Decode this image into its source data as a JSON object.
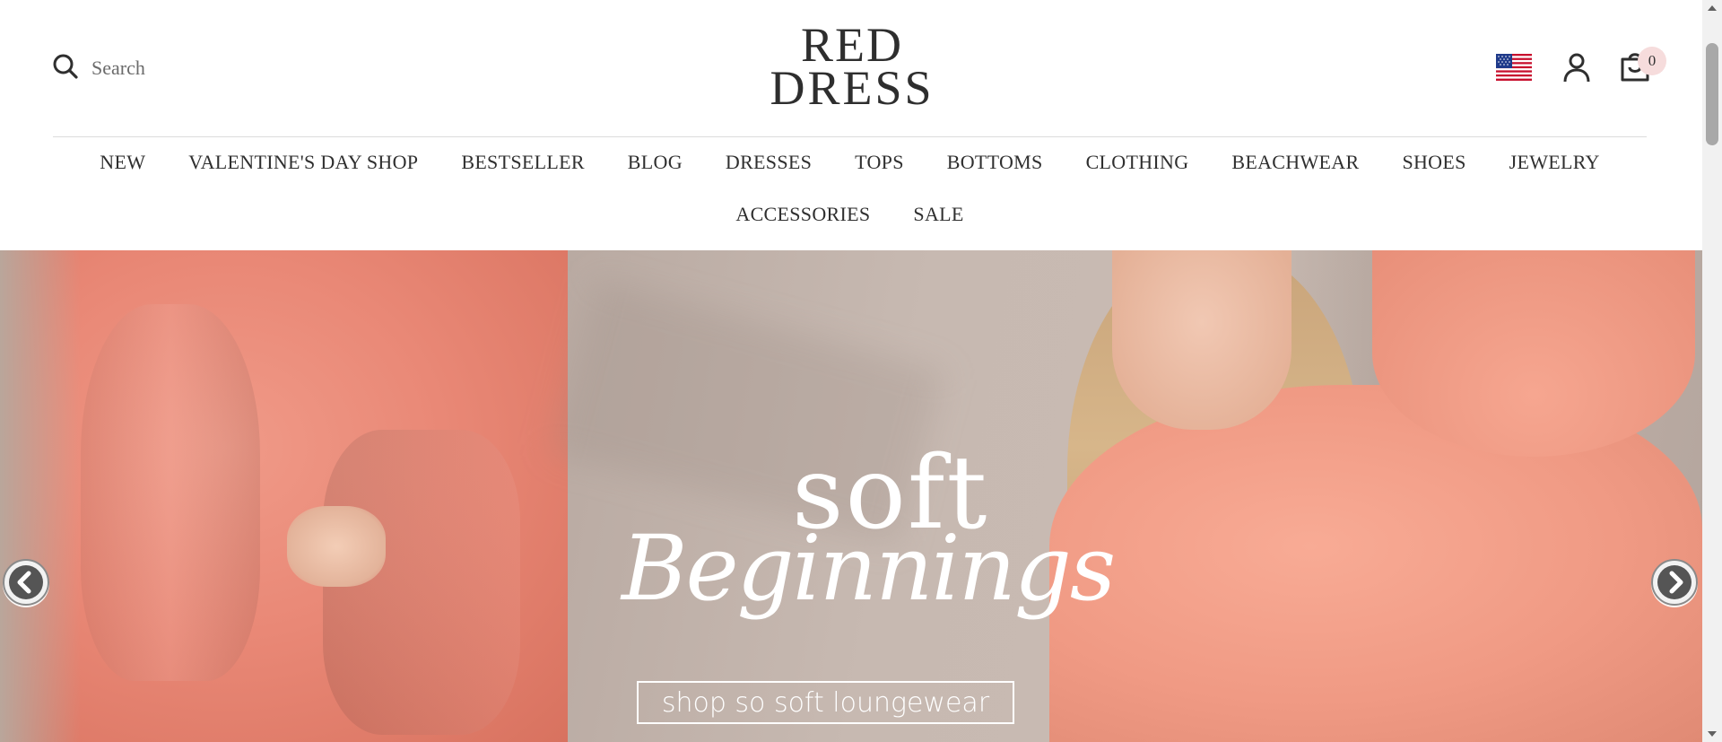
{
  "header": {
    "search_placeholder": "Search",
    "logo_line1": "RED",
    "logo_line2": "DRESS",
    "cart_count": "0",
    "flag_icon": "us-flag-icon",
    "user_icon": "account-icon",
    "cart_icon": "cart-icon"
  },
  "nav": {
    "row1": [
      "NEW",
      "VALENTINE'S DAY SHOP",
      "BESTSELLER",
      "BLOG",
      "DRESSES",
      "TOPS",
      "BOTTOMS",
      "CLOTHING",
      "BEACHWEAR",
      "SHOES",
      "JEWELRY"
    ],
    "row2": [
      "ACCESSORIES",
      "SALE"
    ]
  },
  "hero": {
    "headline_top": "soft",
    "headline_script": "Beginnings",
    "cta_label": "shop so soft loungewear",
    "prev_icon": "chevron-left-icon",
    "next_icon": "chevron-right-icon"
  },
  "colors": {
    "accent_coral": "#f09a84",
    "badge_bg": "#f6dcdc",
    "text_dark": "#2f2f2f"
  }
}
